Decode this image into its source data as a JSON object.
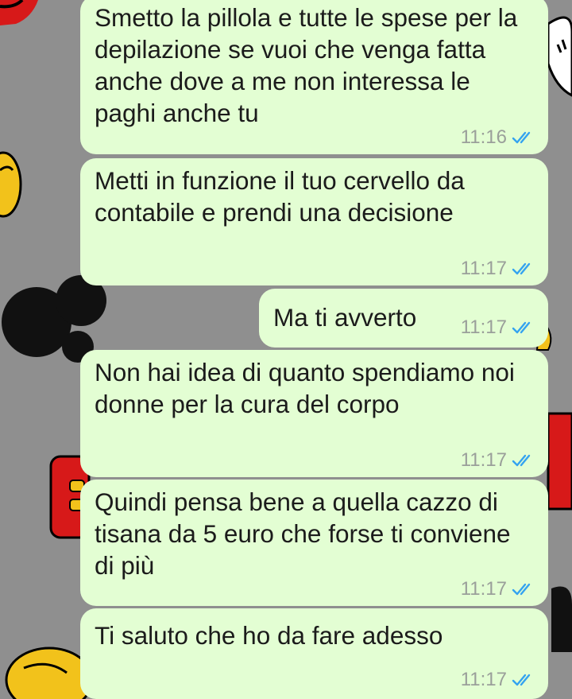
{
  "colors": {
    "wallpaper": "#8f8f8f",
    "bubble_outgoing": "#e3fed3",
    "text": "#1b1b1b",
    "timestamp": "#9a9f9a",
    "read_ticks": "#34a3f0"
  },
  "messages": [
    {
      "text": "Smetto la pillola e tutte le spese per la depilazione se vuoi che venga fatta anche dove a me non interessa le paghi anche tu",
      "time": "11:16",
      "status": "read-ticks-icon"
    },
    {
      "text": "Metti in funzione il tuo cervello da contabile e prendi una decisione",
      "time": "11:17",
      "status": "read-ticks-icon"
    },
    {
      "text": "Ma ti avverto",
      "time": "11:17",
      "status": "read-ticks-icon"
    },
    {
      "text": "Non hai idea di quanto spendiamo noi donne per la cura del corpo",
      "time": "11:17",
      "status": "read-ticks-icon"
    },
    {
      "text": "Quindi pensa bene a quella cazzo di tisana da 5 euro che forse ti conviene di più",
      "time": "11:17",
      "status": "read-ticks-icon"
    },
    {
      "text": "Ti saluto che ho da fare adesso",
      "time": "11:17",
      "status": "read-ticks-icon"
    }
  ]
}
